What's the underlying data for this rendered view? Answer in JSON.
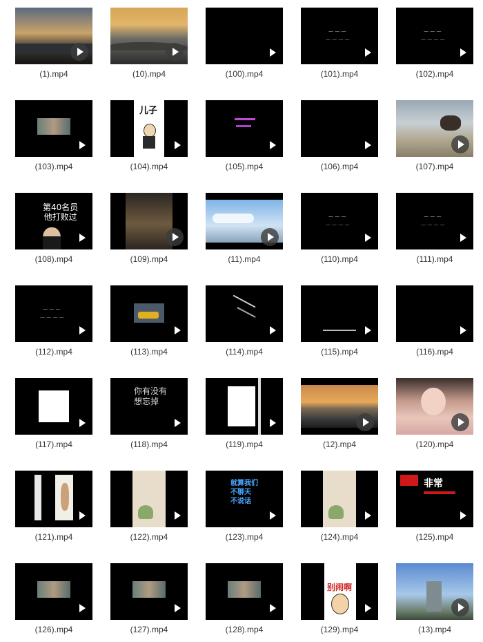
{
  "files": [
    {
      "name": "(1).mp4",
      "preview": "sky-dusk",
      "play_style": "circle"
    },
    {
      "name": "(10).mp4",
      "preview": "sky-sunset",
      "play_style": "circle"
    },
    {
      "name": "(100).mp4",
      "preview": "black",
      "play_style": "plain"
    },
    {
      "name": "(101).mp4",
      "preview": "text-small",
      "play_style": "plain"
    },
    {
      "name": "(102).mp4",
      "preview": "text-small",
      "play_style": "plain"
    },
    {
      "name": "(103).mp4",
      "preview": "small-photo",
      "play_style": "plain"
    },
    {
      "name": "(104).mp4",
      "preview": "cartoon-poster",
      "play_style": "plain",
      "caption": "儿子"
    },
    {
      "name": "(105).mp4",
      "preview": "purple-text",
      "play_style": "plain"
    },
    {
      "name": "(106).mp4",
      "preview": "black",
      "play_style": "plain"
    },
    {
      "name": "(107).mp4",
      "preview": "photo-text",
      "play_style": "circle"
    },
    {
      "name": "(108).mp4",
      "preview": "headline-person",
      "play_style": "plain",
      "caption": "第40名员\n他打败过"
    },
    {
      "name": "(109).mp4",
      "preview": "dark-photo",
      "play_style": "circle"
    },
    {
      "name": "(11).mp4",
      "preview": "blue-sky",
      "play_style": "circle"
    },
    {
      "name": "(110).mp4",
      "preview": "text-small",
      "play_style": "plain"
    },
    {
      "name": "(111).mp4",
      "preview": "text-small",
      "play_style": "plain"
    },
    {
      "name": "(112).mp4",
      "preview": "text-small",
      "play_style": "plain"
    },
    {
      "name": "(113).mp4",
      "preview": "taxi",
      "play_style": "plain"
    },
    {
      "name": "(114).mp4",
      "preview": "text-diagonal",
      "play_style": "plain"
    },
    {
      "name": "(115).mp4",
      "preview": "text-bottom",
      "play_style": "plain"
    },
    {
      "name": "(116).mp4",
      "preview": "black",
      "play_style": "plain"
    },
    {
      "name": "(117).mp4",
      "preview": "white-card",
      "play_style": "plain"
    },
    {
      "name": "(118).mp4",
      "preview": "big-text",
      "play_style": "plain",
      "caption": "你有没有\n想忘掉"
    },
    {
      "name": "(119).mp4",
      "preview": "white-panel",
      "play_style": "plain"
    },
    {
      "name": "(12).mp4",
      "preview": "lake-sunset",
      "play_style": "circle"
    },
    {
      "name": "(120).mp4",
      "preview": "portrait",
      "play_style": "circle"
    },
    {
      "name": "(121).mp4",
      "preview": "split-people",
      "play_style": "plain"
    },
    {
      "name": "(122).mp4",
      "preview": "beige-panel",
      "play_style": "plain"
    },
    {
      "name": "(123).mp4",
      "preview": "blue-headline",
      "play_style": "plain",
      "caption": "就算我们\n不聊天\n不说话"
    },
    {
      "name": "(124).mp4",
      "preview": "beige-panel",
      "play_style": "plain"
    },
    {
      "name": "(125).mp4",
      "preview": "red-headline",
      "play_style": "plain",
      "caption": "非常"
    },
    {
      "name": "(126).mp4",
      "preview": "small-photo",
      "play_style": "plain"
    },
    {
      "name": "(127).mp4",
      "preview": "small-photo",
      "play_style": "plain"
    },
    {
      "name": "(128).mp4",
      "preview": "small-photo",
      "play_style": "plain"
    },
    {
      "name": "(129).mp4",
      "preview": "cartoon-red",
      "play_style": "plain",
      "caption": "别闹啊"
    },
    {
      "name": "(13).mp4",
      "preview": "city-sky",
      "play_style": "circle"
    }
  ]
}
